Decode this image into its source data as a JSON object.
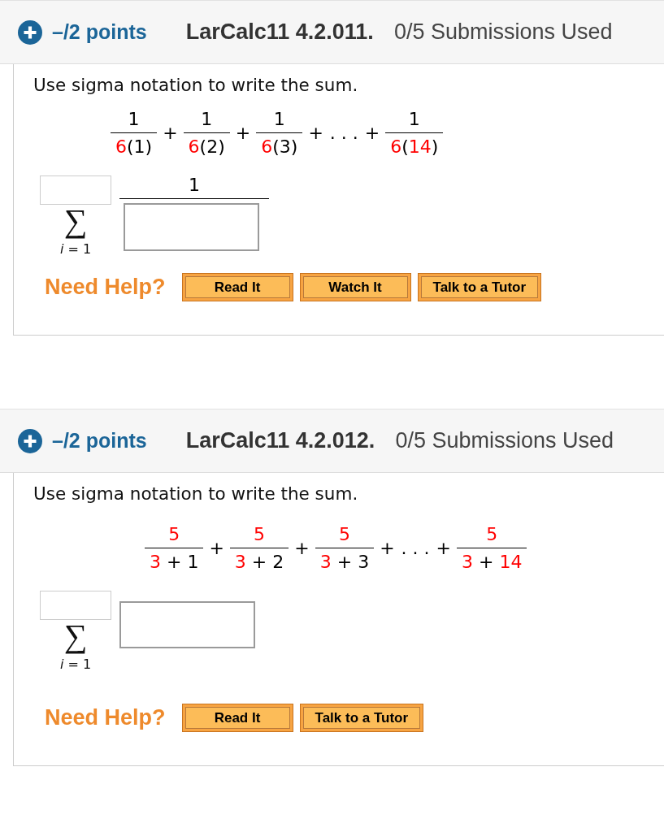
{
  "problems": [
    {
      "header": {
        "points": "–/2 points",
        "code": "LarCalc11 4.2.011.",
        "submissions": "0/5 Submissions Used"
      },
      "prompt": "Use sigma notation to write the sum.",
      "expression": [
        {
          "kind": "fraction",
          "numerator": [
            {
              "text": "1",
              "color": "#000000"
            }
          ],
          "denominator": [
            {
              "text": "6",
              "color": "#ff0000"
            },
            {
              "text": "(1)",
              "color": "#000000"
            }
          ]
        },
        {
          "kind": "operator",
          "text": "+"
        },
        {
          "kind": "fraction",
          "numerator": [
            {
              "text": "1",
              "color": "#000000"
            }
          ],
          "denominator": [
            {
              "text": "6",
              "color": "#ff0000"
            },
            {
              "text": "(2)",
              "color": "#000000"
            }
          ]
        },
        {
          "kind": "operator",
          "text": "+"
        },
        {
          "kind": "fraction",
          "numerator": [
            {
              "text": "1",
              "color": "#000000"
            }
          ],
          "denominator": [
            {
              "text": "6",
              "color": "#ff0000"
            },
            {
              "text": "(3)",
              "color": "#000000"
            }
          ]
        },
        {
          "kind": "operator",
          "text": "+"
        },
        {
          "kind": "operator",
          "text": ". . ."
        },
        {
          "kind": "operator",
          "text": "+"
        },
        {
          "kind": "fraction",
          "numerator": [
            {
              "text": "1",
              "color": "#000000"
            }
          ],
          "denominator": [
            {
              "text": "6",
              "color": "#ff0000"
            },
            {
              "text": "(",
              "color": "#000000"
            },
            {
              "text": "14",
              "color": "#ff0000"
            },
            {
              "text": ")",
              "color": "#000000"
            }
          ]
        }
      ],
      "answer": {
        "kind": "fraction",
        "symbol": "∑",
        "lower_limit": "*i* = 1",
        "numerator": "1"
      },
      "help": {
        "label": "Need Help?",
        "buttons": [
          "Read It",
          "Watch It",
          "Talk to a Tutor"
        ]
      }
    },
    {
      "header": {
        "points": "–/2 points",
        "code": "LarCalc11 4.2.012.",
        "submissions": "0/5 Submissions Used"
      },
      "prompt": "Use sigma notation to write the sum.",
      "expression": [
        {
          "kind": "fraction",
          "numerator": [
            {
              "text": "5",
              "color": "#ff0000"
            }
          ],
          "denominator": [
            {
              "text": "3",
              "color": "#ff0000"
            },
            {
              "text": " + 1",
              "color": "#000000"
            }
          ]
        },
        {
          "kind": "operator",
          "text": "+"
        },
        {
          "kind": "fraction",
          "numerator": [
            {
              "text": "5",
              "color": "#ff0000"
            }
          ],
          "denominator": [
            {
              "text": "3",
              "color": "#ff0000"
            },
            {
              "text": " + 2",
              "color": "#000000"
            }
          ]
        },
        {
          "kind": "operator",
          "text": "+"
        },
        {
          "kind": "fraction",
          "numerator": [
            {
              "text": "5",
              "color": "#ff0000"
            }
          ],
          "denominator": [
            {
              "text": "3",
              "color": "#ff0000"
            },
            {
              "text": " + 3",
              "color": "#000000"
            }
          ]
        },
        {
          "kind": "operator",
          "text": "+"
        },
        {
          "kind": "operator",
          "text": ". . ."
        },
        {
          "kind": "operator",
          "text": "+"
        },
        {
          "kind": "fraction",
          "numerator": [
            {
              "text": "5",
              "color": "#ff0000"
            }
          ],
          "denominator": [
            {
              "text": "3",
              "color": "#ff0000"
            },
            {
              "text": " + ",
              "color": "#000000"
            },
            {
              "text": "14",
              "color": "#ff0000"
            }
          ]
        }
      ],
      "answer": {
        "kind": "field",
        "symbol": "∑",
        "lower_limit": "*i* = 1"
      },
      "help": {
        "label": "Need Help?",
        "buttons": [
          "Read It",
          "Talk to a Tutor"
        ]
      }
    }
  ]
}
